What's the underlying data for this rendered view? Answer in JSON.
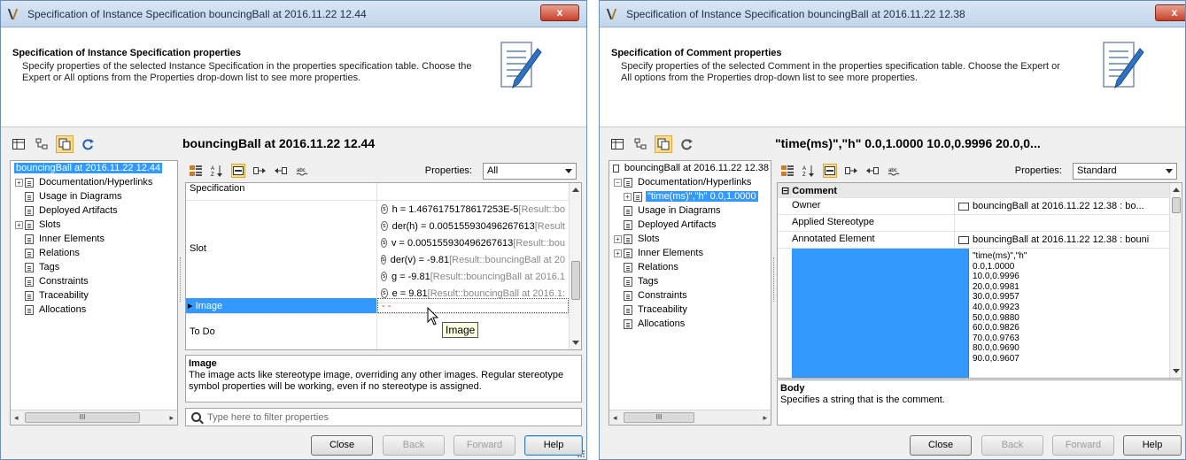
{
  "win1": {
    "title": "Specification of Instance Specification bouncingBall at 2016.11.22 12.44",
    "close_glyph": "x",
    "header_title": "Specification of Instance Specification properties",
    "header_desc": "Specify properties of the selected Instance Specification in the properties specification table. Choose the Expert or All options from the Properties drop-down list to see more properties.",
    "spec_title": "bouncingBall at 2016.11.22 12.44",
    "tree": {
      "root": "bouncingBall at 2016.11.22 12.44",
      "items": [
        "Documentation/Hyperlinks",
        "Usage in Diagrams",
        "Deployed Artifacts",
        "Slots",
        "Inner Elements",
        "Relations",
        "Tags",
        "Constraints",
        "Traceability",
        "Allocations"
      ],
      "scroll_glyph": "III"
    },
    "properties_label": "Properties:",
    "properties_value": "All",
    "grid": {
      "top_row": "Specification",
      "slot_name": "Slot",
      "slots": [
        {
          "text": "h = 1.4676175178617253E-5 ",
          "ref": "[Result::bo"
        },
        {
          "text": "der(h) = 0.005155930496267613 ",
          "ref": "[Result"
        },
        {
          "text": "v = 0.005155930496267613 ",
          "ref": "[Result::bou"
        },
        {
          "text": "der(v) = -9.81 ",
          "ref": "[Result::bouncingBall at 20"
        },
        {
          "text": "g = -9.81 ",
          "ref": "[Result::bouncingBall at 2016.1"
        },
        {
          "text": "e = 9.81 ",
          "ref": "[Result::bouncingBall at 2016.1:"
        }
      ],
      "image_name": "Image",
      "image_value": "- -",
      "todo_name": "To Do"
    },
    "tooltip": "Image",
    "desc_title": "Image",
    "desc_text": "The image acts like stereotype image, overriding any other images. Regular stereotype symbol properties will be working, even if no stereotype is assigned.",
    "filter_placeholder": "Type here to filter properties",
    "buttons": {
      "close": "Close",
      "back": "Back",
      "forward": "Forward",
      "help": "Help"
    }
  },
  "win2": {
    "title": "Specification of Instance Specification bouncingBall at 2016.11.22 12.38",
    "close_glyph": "x",
    "header_title": "Specification of Comment properties",
    "header_desc": "Specify properties of the selected Comment in the properties specification table. Choose the Expert or All options from the Properties drop-down list to see more properties.",
    "spec_title": "\"time(ms)\",\"h\" 0.0,1.0000 10.0,0.9996 20.0,0...",
    "tree": {
      "root": "bouncingBall at 2016.11.22 12.38",
      "doc": "Documentation/Hyperlinks",
      "selected": "\"time(ms)\",\"h\" 0.0,1.0000",
      "items": [
        "Usage in Diagrams",
        "Deployed Artifacts",
        "Slots",
        "Inner Elements",
        "Relations",
        "Tags",
        "Constraints",
        "Traceability",
        "Allocations"
      ],
      "scroll_glyph": "III"
    },
    "properties_label": "Properties:",
    "properties_value": "Standard",
    "grid": {
      "group": "Comment",
      "owner_name": "Owner",
      "owner_value": "bouncingBall at 2016.11.22 12.38 : bo...",
      "applied_name": "Applied Stereotype",
      "annotated_name": "Annotated Element",
      "annotated_value": "bouncingBall at 2016.11.22 12.38 : bouni",
      "body_lines": [
        "\"time(ms)\",\"h\"",
        "0.0,1.0000",
        "10.0,0.9996",
        "20.0,0.9981",
        "30.0,0.9957",
        "40.0,0.9923",
        "50.0,0.9880",
        "60.0,0.9826",
        "70.0,0.9763",
        "80.0,0.9690",
        "90.0,0.9607"
      ]
    },
    "desc_title": "Body",
    "desc_text": "Specifies a string that is the comment.",
    "buttons": {
      "close": "Close",
      "back": "Back",
      "forward": "Forward",
      "help": "Help"
    }
  }
}
